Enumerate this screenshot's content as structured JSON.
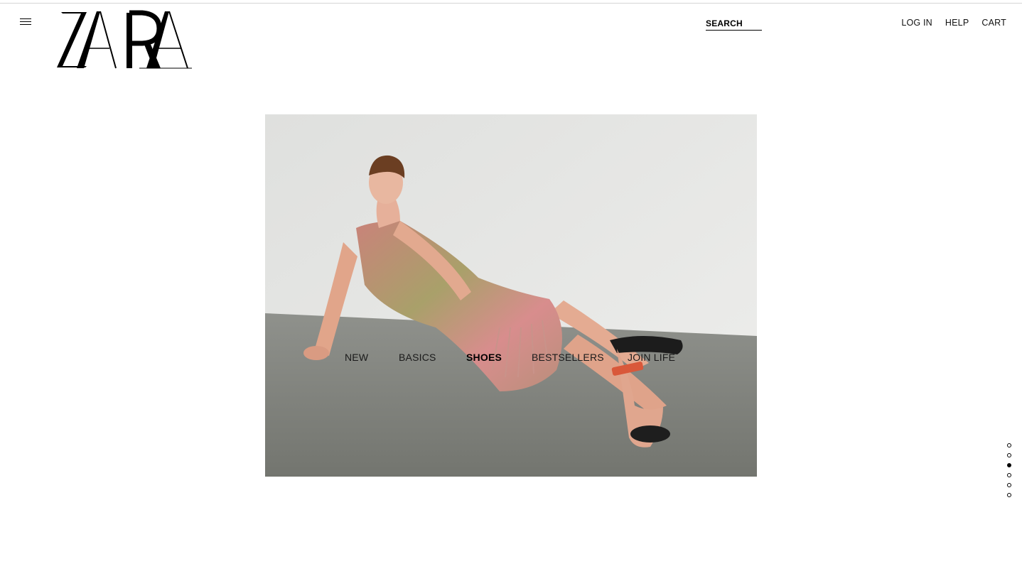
{
  "brand": {
    "logo_text": "ZARA"
  },
  "header": {
    "menu_icon": "hamburger-menu-icon",
    "search_label": "SEARCH",
    "links": [
      {
        "label": "LOG IN"
      },
      {
        "label": "HELP"
      },
      {
        "label": "CART"
      }
    ]
  },
  "hero": {
    "image": "model-in-knit-dress-and-sandals-photo",
    "categories": [
      {
        "label": "NEW",
        "active": false
      },
      {
        "label": "BASICS",
        "active": false
      },
      {
        "label": "SHOES",
        "active": true
      },
      {
        "label": "BESTSELLERS",
        "active": false
      },
      {
        "label": "JOIN LIFE",
        "active": false
      }
    ]
  },
  "slider": {
    "count": 6,
    "active_index": 2
  }
}
